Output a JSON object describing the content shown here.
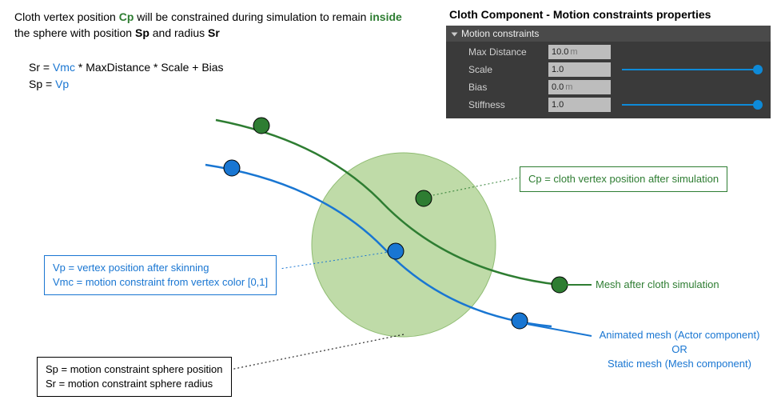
{
  "description": {
    "prefix": "Cloth vertex position ",
    "cp": "Cp",
    "mid1": " will be constrained during simulation to remain ",
    "inside": "inside",
    "mid2": " the sphere with position ",
    "sp": "Sp",
    "mid3": " and radius ",
    "sr": "Sr"
  },
  "formula": {
    "sr_prefix": "Sr = ",
    "vmc": "Vmc",
    "sr_suffix": " * MaxDistance * Scale + Bias",
    "sp_prefix": "Sp = ",
    "vp": "Vp"
  },
  "panel": {
    "title": "Cloth Component - Motion constraints properties",
    "section": "Motion constraints",
    "rows": {
      "max_distance": {
        "label": "Max Distance",
        "value": "10.0",
        "unit": "m"
      },
      "scale": {
        "label": "Scale",
        "value": "1.0"
      },
      "bias": {
        "label": "Bias",
        "value": "0.0",
        "unit": "m"
      },
      "stiffness": {
        "label": "Stiffness",
        "value": "1.0"
      }
    }
  },
  "legends": {
    "cp": "Cp = cloth vertex position after simulation",
    "vp_line1": "Vp = vertex position after skinning",
    "vp_line2": "Vmc = motion constraint from vertex color [0,1]",
    "sp_line1": "Sp = motion constraint sphere position",
    "sp_line2": "Sr = motion constraint sphere radius",
    "mesh_after": "Mesh after cloth simulation",
    "animated_line1": "Animated mesh (Actor component)",
    "animated_or": "OR",
    "animated_line2": "Static mesh (Mesh component)"
  },
  "colors": {
    "green": "#2e7d32",
    "blue": "#1976d2",
    "sphere_fill": "#a9cf8b",
    "sphere_stroke": "#8fbc72"
  }
}
